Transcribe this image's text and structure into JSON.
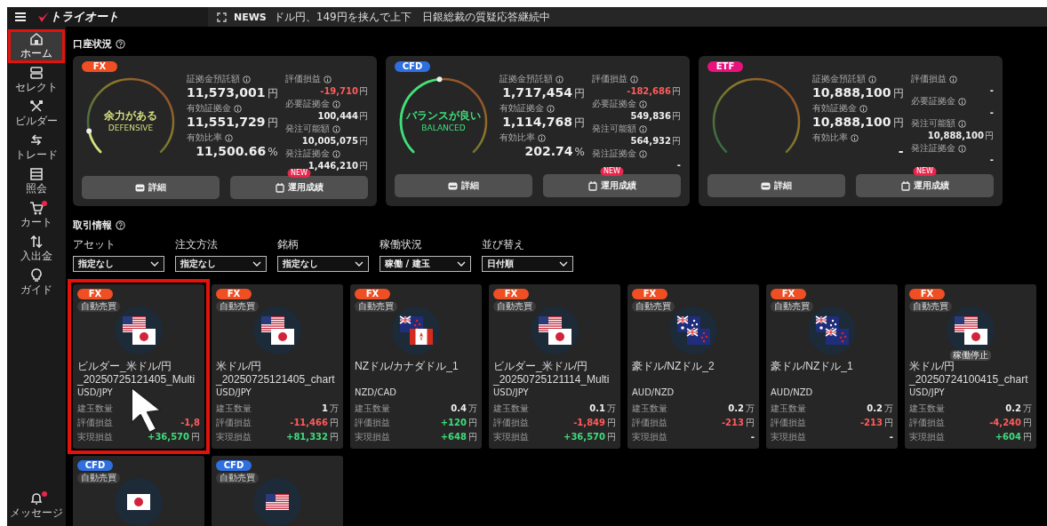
{
  "header": {
    "logo": "トライオート",
    "news_label": "NEWS",
    "news_text": "ドル円、149円を挟んで上下　日銀総裁の質疑応答継続中"
  },
  "sidebar": {
    "items": [
      {
        "kind": "home",
        "label": "ホーム",
        "selected": true,
        "highlighted": true,
        "badge": false
      },
      {
        "kind": "select",
        "label": "セレクト",
        "selected": false,
        "highlighted": false,
        "badge": false
      },
      {
        "kind": "builder",
        "label": "ビルダー",
        "selected": false,
        "highlighted": false,
        "badge": false
      },
      {
        "kind": "trade",
        "label": "トレード",
        "selected": false,
        "highlighted": false,
        "badge": false
      },
      {
        "kind": "list",
        "label": "照会",
        "selected": false,
        "highlighted": false,
        "badge": false
      },
      {
        "kind": "cart",
        "label": "カート",
        "selected": false,
        "highlighted": false,
        "badge": true
      },
      {
        "kind": "transfer",
        "label": "入出金",
        "selected": false,
        "highlighted": false,
        "badge": false
      },
      {
        "kind": "guide",
        "label": "ガイド",
        "selected": false,
        "highlighted": false,
        "badge": false
      }
    ],
    "bottom": {
      "kind": "bell",
      "label": "メッセージ",
      "badge": true
    }
  },
  "account": {
    "title": "口座状況",
    "cards": [
      {
        "asset": "FX",
        "color": "#f04e23",
        "kind": "defensive",
        "status": "余力がある",
        "status_en": "DEFENSIVE",
        "level": 0.12,
        "fields": [
          {
            "label": "証拠金預託額",
            "value": "11,573,001",
            "unit": "円"
          },
          {
            "label": "有効証拠金",
            "value": "11,551,729",
            "unit": "円"
          },
          {
            "label": "有効比率",
            "value": "11,500.66",
            "unit": "%"
          }
        ],
        "side": [
          {
            "label": "評価損益",
            "value": "-19,710",
            "unit": "円",
            "kind": "loss"
          },
          {
            "label": "必要証拠金",
            "value": "100,444",
            "unit": "円",
            "kind": "plain"
          },
          {
            "label": "発注可能額",
            "value": "10,005,075",
            "unit": "円",
            "kind": "plain"
          },
          {
            "label": "発注証拠金",
            "value": "1,446,210",
            "unit": "円",
            "kind": "plain"
          }
        ],
        "buttons": [
          {
            "kind": "details",
            "label": "詳細"
          },
          {
            "kind": "performance",
            "label": "運用成績",
            "badge": "NEW"
          }
        ]
      },
      {
        "asset": "CFD",
        "color": "#2f6fe0",
        "kind": "balanced",
        "status": "バランスが良い",
        "status_en": "BALANCED",
        "level": 0.48,
        "fields": [
          {
            "label": "証拠金預託額",
            "value": "1,717,454",
            "unit": "円"
          },
          {
            "label": "有効証拠金",
            "value": "1,114,768",
            "unit": "円"
          },
          {
            "label": "有効比率",
            "value": "202.74",
            "unit": "%"
          }
        ],
        "side": [
          {
            "label": "評価損益",
            "value": "-182,686",
            "unit": "円",
            "kind": "loss"
          },
          {
            "label": "必要証拠金",
            "value": "549,836",
            "unit": "円",
            "kind": "plain"
          },
          {
            "label": "発注可能額",
            "value": "564,932",
            "unit": "円",
            "kind": "plain"
          },
          {
            "label": "発注証拠金",
            "value": "-",
            "kind": "plain"
          }
        ],
        "buttons": [
          {
            "kind": "details",
            "label": "詳細"
          },
          {
            "kind": "performance",
            "label": "運用成績",
            "badge": "NEW"
          }
        ]
      },
      {
        "asset": "ETF",
        "color": "#e8127c",
        "fields": [
          {
            "label": "証拠金預託額",
            "value": "10,888,100",
            "unit": "円"
          },
          {
            "label": "有効証拠金",
            "value": "10,888,100",
            "unit": "円"
          },
          {
            "label": "有効比率",
            "value": "-"
          }
        ],
        "side": [
          {
            "label": "評価損益",
            "value": "-",
            "kind": "plain"
          },
          {
            "label": "必要証拠金",
            "value": "-",
            "kind": "plain"
          },
          {
            "label": "発注可能額",
            "value": "10,888,100",
            "unit": "円",
            "kind": "plain"
          },
          {
            "label": "発注証拠金",
            "value": "-",
            "kind": "plain"
          }
        ],
        "buttons": [
          {
            "kind": "details",
            "label": "詳細"
          },
          {
            "kind": "performance",
            "label": "運用成績",
            "badge": "NEW"
          }
        ]
      }
    ]
  },
  "trades": {
    "title": "取引情報",
    "filters": [
      {
        "label": "アセット",
        "value": "指定なし"
      },
      {
        "label": "注文方法",
        "value": "指定なし"
      },
      {
        "label": "銘柄",
        "value": "指定なし"
      },
      {
        "label": "稼働状況",
        "value": "稼働 / 建玉"
      },
      {
        "label": "並び替え",
        "value": "日付順"
      }
    ],
    "cards": [
      {
        "asset": "FX",
        "color": "#f04e23",
        "mode": "自動売買",
        "kind": "us-jp",
        "highlighted": true,
        "name": "ビルダー_米ドル/円_20250725121405_Multi",
        "pair": "USD/JPY",
        "rows": [
          {
            "label": "建玉数量"
          },
          {
            "label": "評価損益",
            "value": "-1,8",
            "kind": "loss"
          },
          {
            "label": "実現損益",
            "value": "+36,570",
            "unit": "円",
            "kind": "gain"
          }
        ]
      },
      {
        "asset": "FX",
        "color": "#f04e23",
        "mode": "自動売買",
        "kind": "us-jp",
        "highlighted": false,
        "name": "米ドル/円_20250725121405_chart",
        "pair": "USD/JPY",
        "rows": [
          {
            "label": "建玉数量",
            "value": "1",
            "unit": "万",
            "kind": "plain"
          },
          {
            "label": "評価損益",
            "value": "-11,466",
            "unit": "円",
            "kind": "loss"
          },
          {
            "label": "実現損益",
            "value": "+81,332",
            "unit": "円",
            "kind": "gain"
          }
        ]
      },
      {
        "asset": "FX",
        "color": "#f04e23",
        "mode": "自動売買",
        "kind": "nz-ca",
        "highlighted": false,
        "name": "NZドル/カナダドル_1",
        "pair": "NZD/CAD",
        "rows": [
          {
            "label": "建玉数量",
            "value": "0.4",
            "unit": "万",
            "kind": "plain"
          },
          {
            "label": "評価損益",
            "value": "+120",
            "unit": "円",
            "kind": "gain"
          },
          {
            "label": "実現損益",
            "value": "+648",
            "unit": "円",
            "kind": "gain"
          }
        ]
      },
      {
        "asset": "FX",
        "color": "#f04e23",
        "mode": "自動売買",
        "kind": "us-jp",
        "highlighted": false,
        "name": "ビルダー_米ドル/円_20250725121114_Multi",
        "pair": "USD/JPY",
        "rows": [
          {
            "label": "建玉数量",
            "value": "0.1",
            "unit": "万",
            "kind": "plain"
          },
          {
            "label": "評価損益",
            "value": "-1,849",
            "unit": "円",
            "kind": "loss"
          },
          {
            "label": "実現損益",
            "value": "+36,570",
            "unit": "円",
            "kind": "gain"
          }
        ]
      },
      {
        "asset": "FX",
        "color": "#f04e23",
        "mode": "自動売買",
        "kind": "au-nz",
        "highlighted": false,
        "name": "豪ドル/NZドル_2",
        "pair": "AUD/NZD",
        "rows": [
          {
            "label": "建玉数量",
            "value": "0.2",
            "unit": "万",
            "kind": "plain"
          },
          {
            "label": "評価損益",
            "value": "-213",
            "unit": "円",
            "kind": "loss"
          },
          {
            "label": "実現損益",
            "value": "-",
            "kind": "plain"
          }
        ]
      },
      {
        "asset": "FX",
        "color": "#f04e23",
        "mode": "自動売買",
        "kind": "au-nz",
        "highlighted": false,
        "name": "豪ドル/NZドル_1",
        "pair": "AUD/NZD",
        "rows": [
          {
            "label": "建玉数量",
            "value": "0.2",
            "unit": "万",
            "kind": "plain"
          },
          {
            "label": "評価損益",
            "value": "-213",
            "unit": "円",
            "kind": "loss"
          },
          {
            "label": "実現損益",
            "value": "-",
            "kind": "plain"
          }
        ]
      },
      {
        "asset": "FX",
        "color": "#f04e23",
        "mode": "自動売買",
        "kind": "us-jp",
        "highlighted": false,
        "paused": "稼働停止",
        "name": "米ドル/円_20250724100415_chart",
        "pair": "USD/JPY",
        "rows": [
          {
            "label": "建玉数量",
            "value": "0.2",
            "unit": "万",
            "kind": "plain"
          },
          {
            "label": "評価損益",
            "value": "-4,240",
            "unit": "円",
            "kind": "loss"
          },
          {
            "label": "実現損益",
            "value": "+604",
            "unit": "円",
            "kind": "gain"
          }
        ]
      },
      {
        "asset": "CFD",
        "color": "#2f6fe0",
        "mode": "自動売買",
        "kind": "jp"
      },
      {
        "asset": "CFD",
        "color": "#2f6fe0",
        "mode": "自動売買",
        "kind": "us"
      }
    ]
  }
}
